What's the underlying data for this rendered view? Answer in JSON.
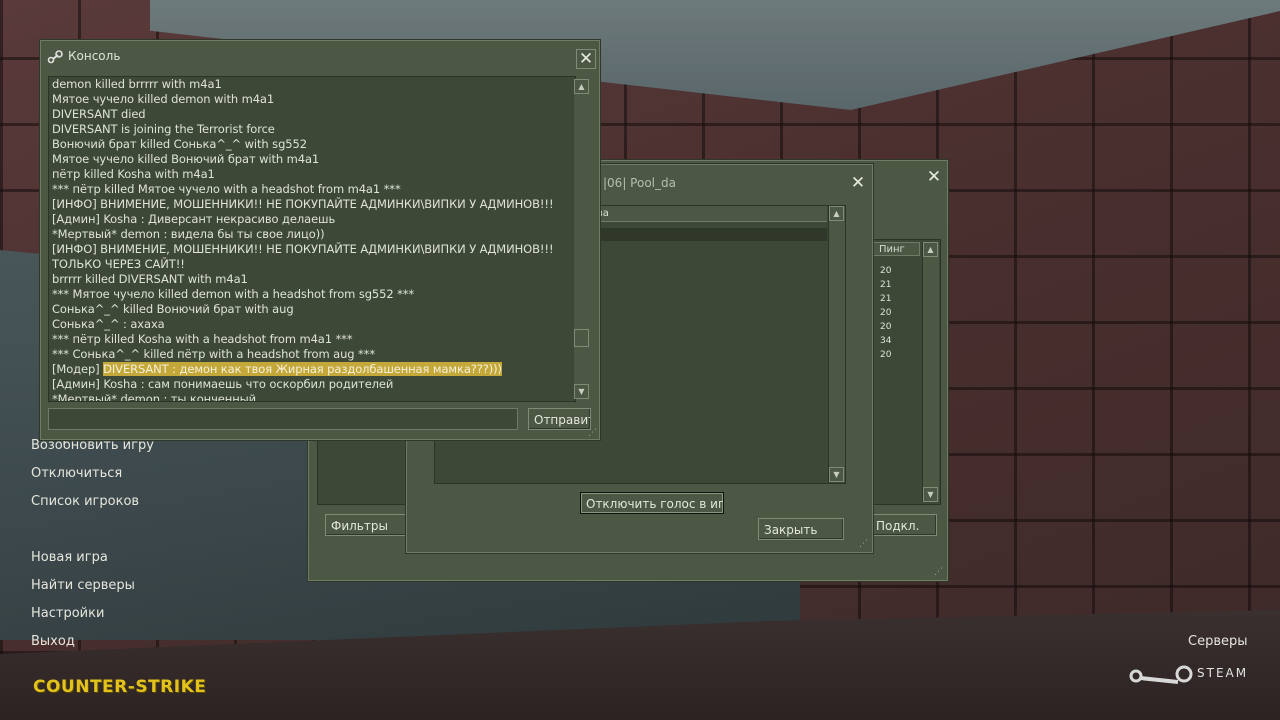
{
  "main_menu": {
    "items": [
      "Возобновить игру",
      "Отключиться",
      "Список игроков",
      "Новая игра",
      "Найти серверы",
      "Настройки",
      "Выход"
    ],
    "servers_link": "Серверы",
    "logo_text": "COUNTER-STRIKE",
    "steam_text": "STEAM"
  },
  "console": {
    "title": "Консоль",
    "send_label": "Отправить",
    "input_value": "",
    "lines": [
      {
        "text": "demon killed brrrrr with m4a1"
      },
      {
        "text": "Мятое чучело killed demon with m4a1"
      },
      {
        "text": "DIVERSANT died"
      },
      {
        "text": "DIVERSANT is joining the Terrorist force"
      },
      {
        "text": "Вонючий брат killed Сонька^_^ with sg552"
      },
      {
        "text": "Мятое чучело killed Вонючий брат with m4a1"
      },
      {
        "text": "пётр killed Kosha with m4a1"
      },
      {
        "text": "*** пётр killed Мятое чучело with a headshot from m4a1 ***"
      },
      {
        "text": "[ИНФО] ВНИМЕНИЕ, МОШЕННИКИ!! НЕ ПОКУПАЙТЕ АДМИНКИ\\ВИПКИ У АДМИНОВ!!!"
      },
      {
        "text": "[Админ] Kosha :  Диверсант некрасиво делаешь"
      },
      {
        "text": "*Мертвый* demon :  видела бы ты свое лицо))"
      },
      {
        "text": "[ИНФО] ВНИМЕНИЕ, МОШЕННИКИ!! НЕ ПОКУПАЙТЕ АДМИНКИ\\ВИПКИ У АДМИНОВ!!!"
      },
      {
        "text": "ТОЛЬКО ЧЕРЕЗ САЙТ!!"
      },
      {
        "text": "brrrrr killed DIVERSANT with m4a1"
      },
      {
        "text": "*** Мятое чучело killed demon with a headshot from sg552 ***"
      },
      {
        "text": "Сонька^_^ killed Вонючий брат with aug"
      },
      {
        "text": "Сонька^_^ :  ахаха"
      },
      {
        "text": "*** пётр killed Kosha with a headshot from m4a1 ***"
      },
      {
        "text": "*** Сонька^_^ killed пётр with a headshot from aug ***"
      },
      {
        "prefix": "[Модер] ",
        "highlight": "DIVERSANT :  демон как твоя Жирная раздолбашенная мамка???)))"
      },
      {
        "text": "[Админ] Kosha :  сам понимаешь что оскорбил родителей"
      },
      {
        "text": "*Мертвый* demon :  ты конченный"
      }
    ]
  },
  "player_list": {
    "title_fragment": "|06| Pool_da",
    "column_fragment": "тва",
    "mute_label": "Отключить голос в игре",
    "close_label": "Закрыть"
  },
  "server_browser": {
    "ping_header": "Пинг",
    "pings": [
      "20",
      "21",
      "21",
      "20",
      "20",
      "34",
      "20"
    ],
    "filters_label": "Фильтры",
    "connect_fragment": "Подкл."
  }
}
